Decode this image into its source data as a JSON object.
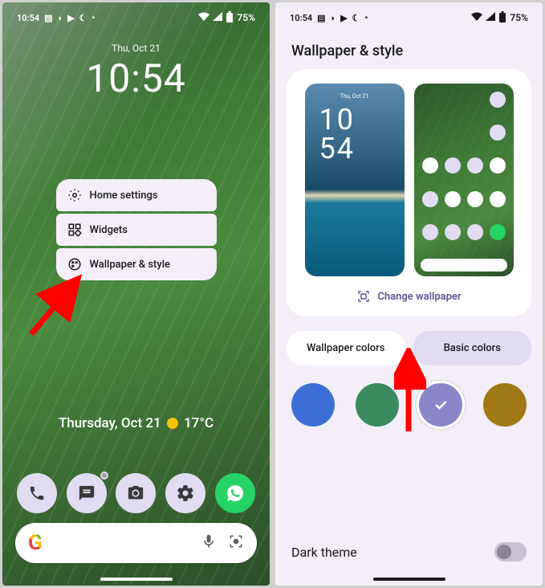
{
  "status": {
    "time": "10:54",
    "battery": "75%"
  },
  "lock": {
    "date": "Thu, Oct 21",
    "time": "10:54"
  },
  "menu": {
    "home_settings": "Home settings",
    "widgets": "Widgets",
    "wallpaper_style": "Wallpaper & style"
  },
  "weather": {
    "date": "Thursday, Oct 21",
    "temp": "17°C"
  },
  "search": {
    "logo": "G"
  },
  "right": {
    "title": "Wallpaper & style",
    "preview_lock_date": "Thu, Oct 21",
    "preview_lock_time_h": "10",
    "preview_lock_time_m": "54",
    "change_wallpaper": "Change wallpaper",
    "tab_wallpaper": "Wallpaper colors",
    "tab_basic": "Basic colors",
    "dark_theme": "Dark theme"
  },
  "colors": {
    "blue": "#3b6fd6",
    "green": "#3b8a5d",
    "purple": "#8b86c9",
    "gold": "#a07814"
  }
}
